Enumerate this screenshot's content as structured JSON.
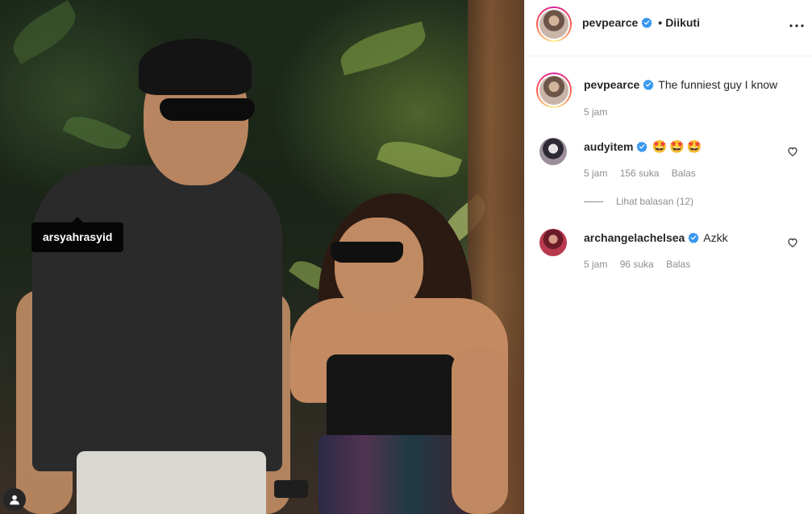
{
  "photo": {
    "tag_label": "arsyahrasyid"
  },
  "header": {
    "username": "pevpearce",
    "separator": "•",
    "follow_status": "Diikuti"
  },
  "caption": {
    "username": "pevpearce",
    "text": "The funniest guy I know",
    "time": "5 jam"
  },
  "comments": [
    {
      "username": "audyitem",
      "text": "🤩🤩🤩",
      "time": "5 jam",
      "likes": "156 suka",
      "reply": "Balas",
      "view_replies": "Lihat balasan (12)"
    },
    {
      "username": "archangelachelsea",
      "text": "Azkk",
      "time": "5 jam",
      "likes": "96 suka",
      "reply": "Balas"
    }
  ],
  "icons": {
    "verified": "verified-badge-icon",
    "more": "more-options-icon",
    "heart": "heart-icon",
    "user_tag": "user-tag-icon"
  },
  "colors": {
    "verified_blue": "#3897f0",
    "text": "#262626",
    "secondary": "#8e8e8e",
    "divider": "#efefef"
  }
}
